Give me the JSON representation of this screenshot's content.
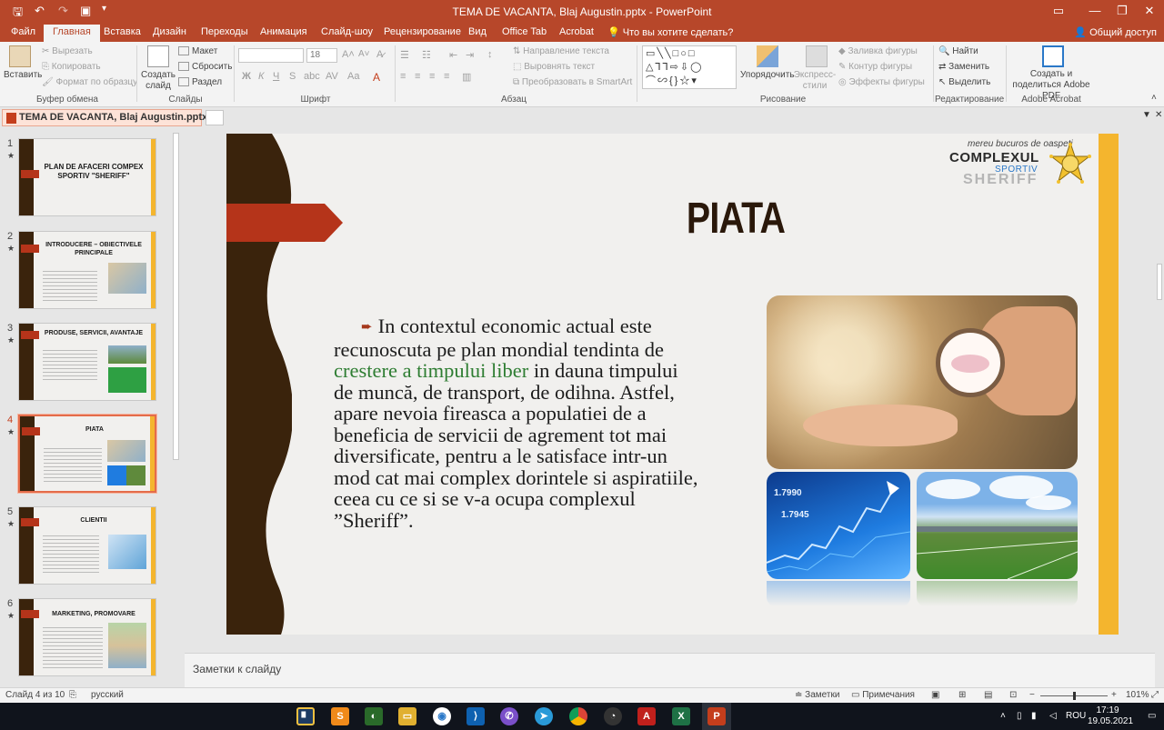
{
  "app": {
    "window_title": "TEMA DE VACANTA, Blaj Augustin.pptx  -  PowerPoint"
  },
  "ribbon_tabs": {
    "file": "Файл",
    "home": "Главная",
    "insert": "Вставка",
    "design": "Дизайн",
    "transitions": "Переходы",
    "animation": "Анимация",
    "slideshow": "Слайд-шоу",
    "review": "Рецензирование",
    "view": "Вид",
    "officetab": "Office Tab",
    "acrobat": "Acrobat",
    "tellme": "Что вы хотите сделать?",
    "share": "Общий доступ"
  },
  "ribbon": {
    "paste": "Вставить",
    "cut": "Вырезать",
    "copy": "Копировать",
    "format_painter": "Формат по образцу",
    "clipboard_group": "Буфер обмена",
    "new_slide": "Создать слайд",
    "layout": "Макет",
    "reset": "Сбросить",
    "section": "Раздел",
    "slides_group": "Слайды",
    "font_size": "18",
    "font_group": "Шрифт",
    "text_direction": "Направление текста",
    "align_text": "Выровнять текст",
    "convert_smartart": "Преобразовать в SmartArt",
    "paragraph_group": "Абзац",
    "arrange": "Упорядочить",
    "quick_styles": "Экспресс-стили",
    "shape_fill": "Заливка фигуры",
    "shape_outline": "Контур фигуры",
    "shape_effects": "Эффекты фигуры",
    "drawing_group": "Рисование",
    "find": "Найти",
    "replace": "Заменить",
    "select": "Выделить",
    "editing_group": "Редактирование",
    "create_share_pdf": "Создать и поделиться Adobe PDF",
    "acrobat_group": "Adobe Acrobat"
  },
  "doc_tab": {
    "name": "TEMA DE VACANTA, Blaj Augustin.pptx"
  },
  "thumbnails": [
    {
      "num": "1",
      "title": "PLAN DE AFACERI COMPEX SPORTIV \"SHERIFF\""
    },
    {
      "num": "2",
      "title": "INTRODUCERE – OBIECTIVELE PRINCIPALE"
    },
    {
      "num": "3",
      "title": "PRODUSE, SERVICII, AVANTAJE"
    },
    {
      "num": "4",
      "title": "PIATA"
    },
    {
      "num": "5",
      "title": "CLIENTII"
    },
    {
      "num": "6",
      "title": "MARKETING, PROMOVARE"
    }
  ],
  "slide": {
    "title": "PIATA",
    "body_1": "In contextul economic actual este recunoscuta pe plan mondial tendinta de ",
    "body_highlight": "crestere a timpului liber",
    "body_2": " in dauna timpului de muncă, de transport, de odihna. Astfel, apare nevoia fireasca a populatiei de a beneficia de servicii de agrement tot mai diversificate, pentru a le satisface intr-un mod cat mai complex dorintele si aspiratiile, ceea cu ce si se v-a ocupa complexul ”Sheriff”.",
    "logo_tagline": "mereu bucuros de oaspeți",
    "logo_complex": "COMPLEXUL",
    "logo_sportiv": "SPORTIV",
    "logo_sheriff": "SHERIFF",
    "fin_num_1": "1.7990",
    "fin_num_2": "1.7945",
    "colors": {
      "accent": "#b7472a",
      "bar": "#3a230c",
      "right_bar": "#f4b52e",
      "highlight": "#2e7d32"
    }
  },
  "notes": {
    "placeholder": "Заметки к слайду"
  },
  "statusbar": {
    "slide_info": "Слайд 4 из 10",
    "language": "русский",
    "notes": "Заметки",
    "comments": "Примечания",
    "zoom": "101%"
  },
  "taskbar": {
    "lang": "ROU",
    "time": "17:19",
    "date": "19.05.2021"
  }
}
